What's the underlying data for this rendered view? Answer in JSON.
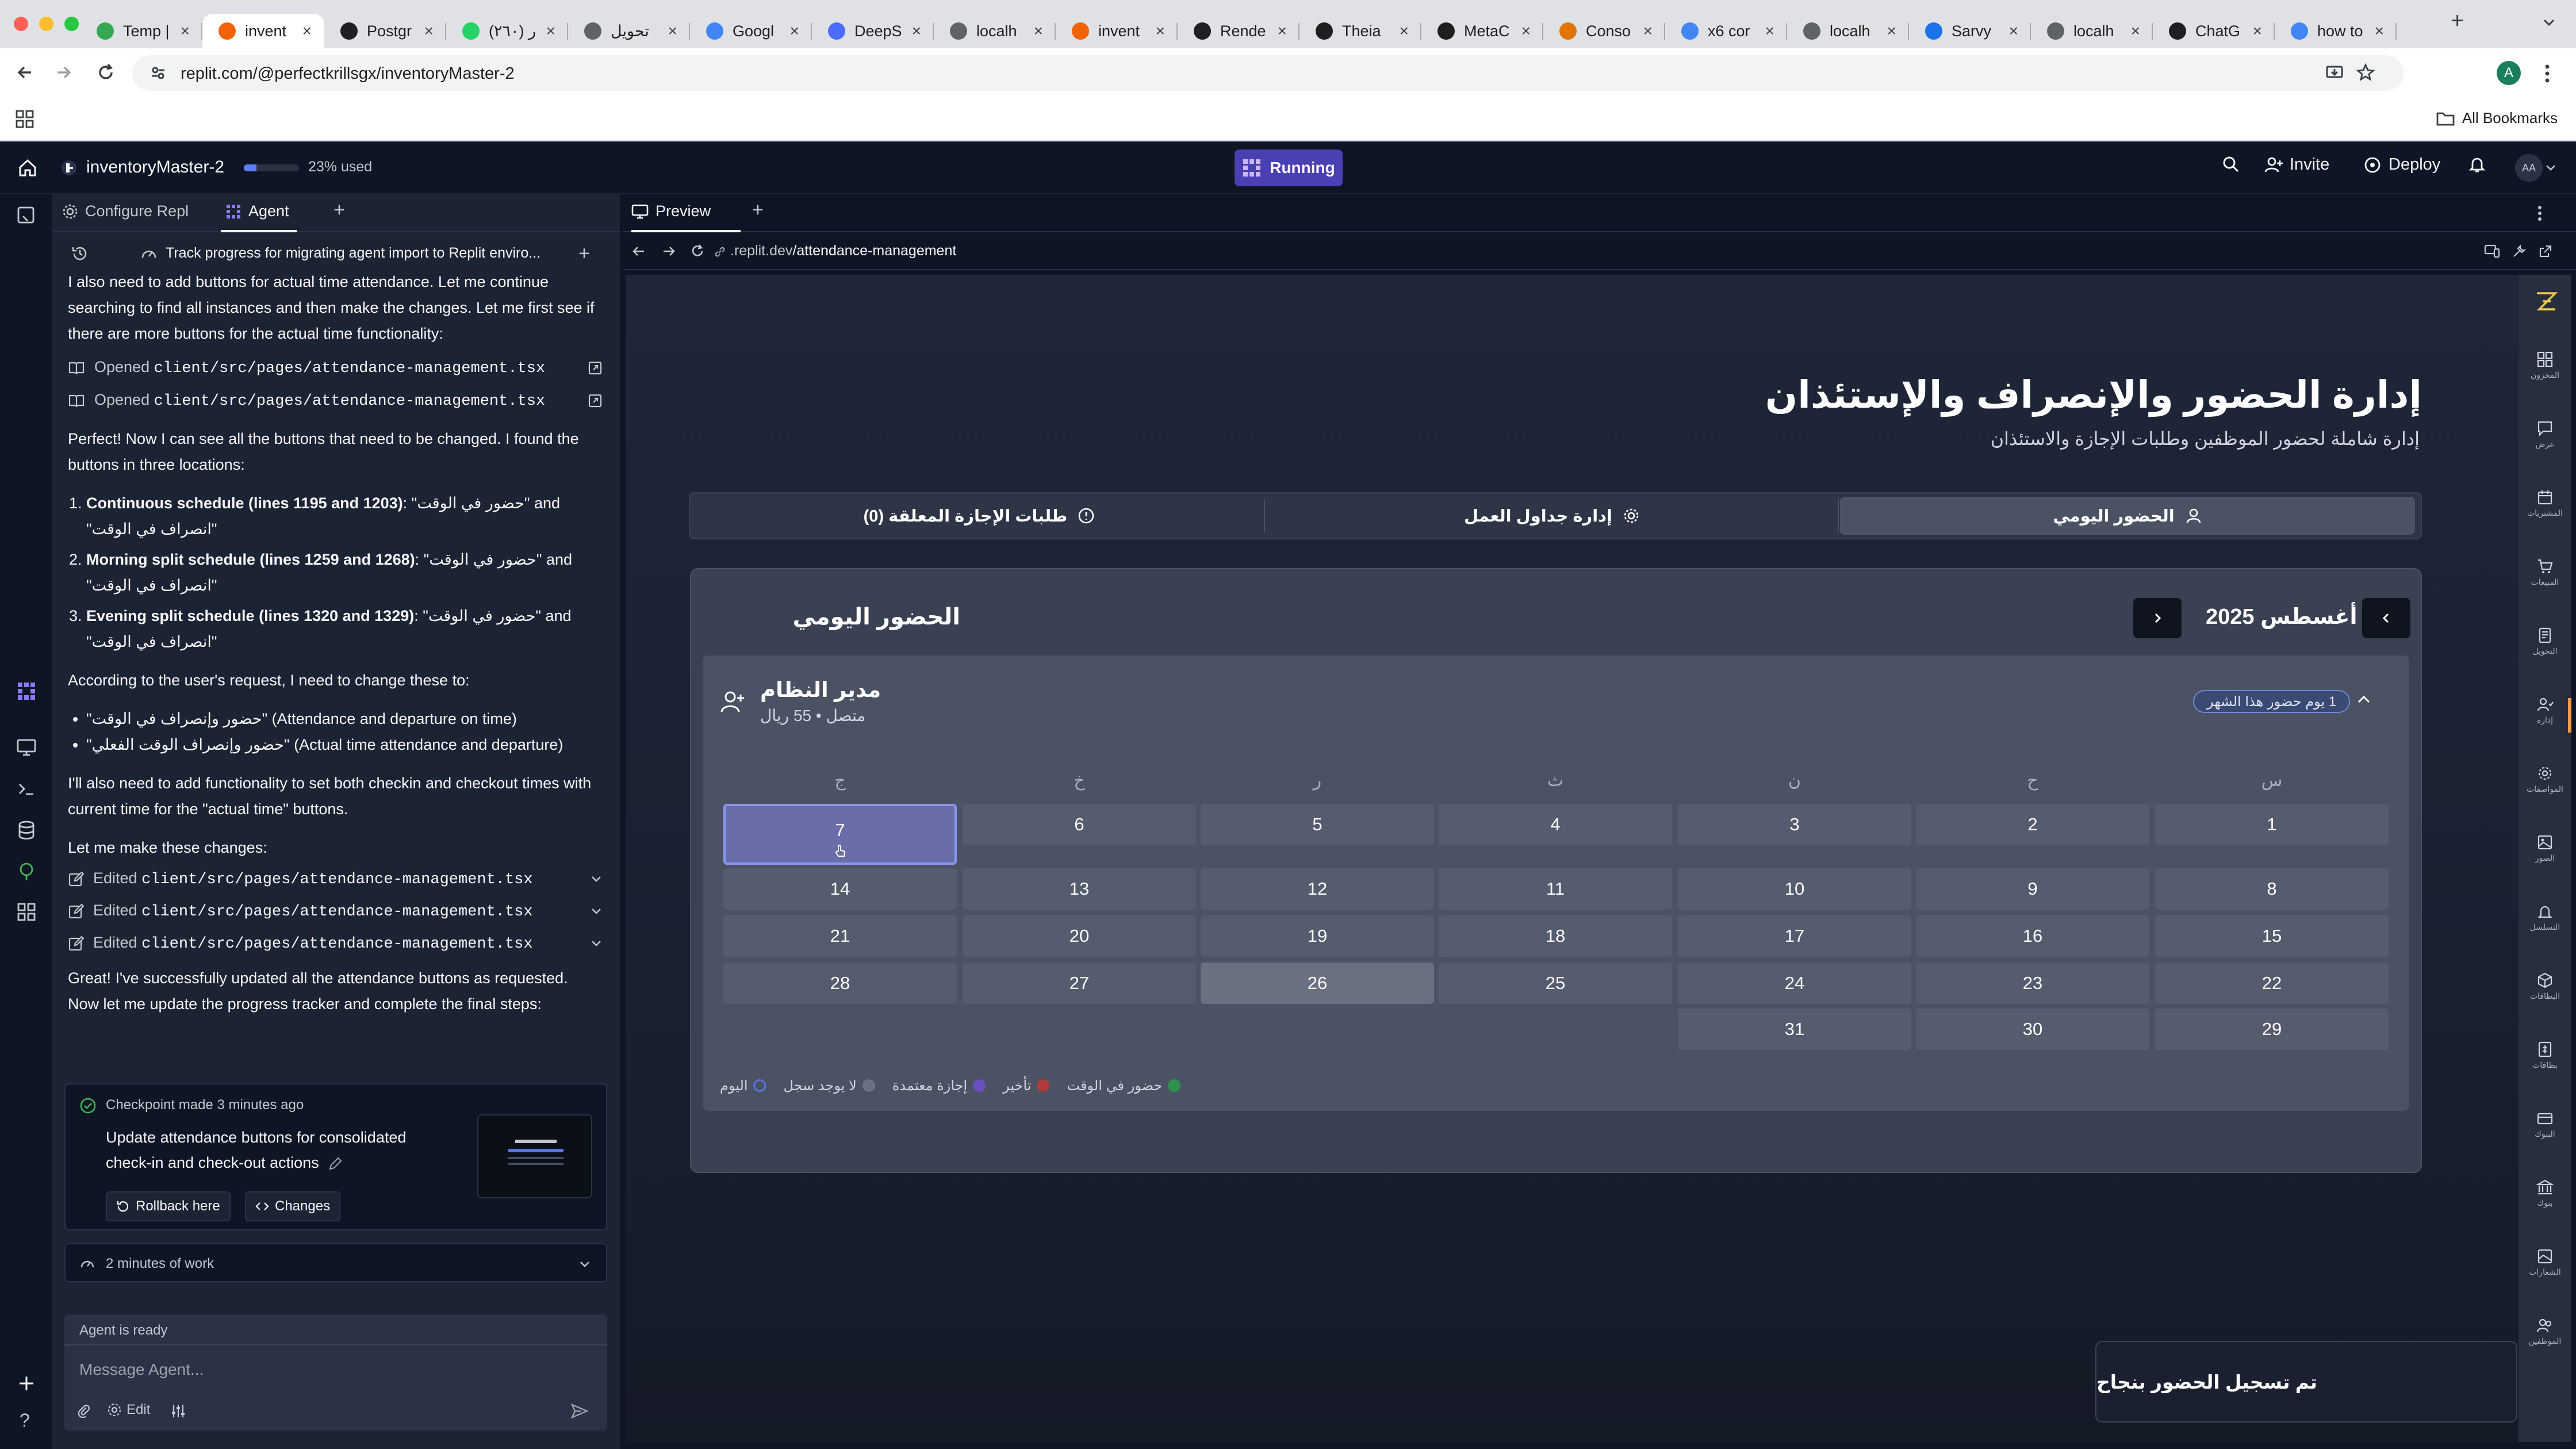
{
  "browser": {
    "tabs": [
      {
        "label": "Temp |",
        "color": "#34a853"
      },
      {
        "label": "invent",
        "color": "#f26207",
        "active": true
      },
      {
        "label": "Postgr",
        "color": "#1f1f1f"
      },
      {
        "label": "(٢٦٠) ر",
        "color": "#25d366"
      },
      {
        "label": "تحويل",
        "color": "#5f6368"
      },
      {
        "label": "Googl",
        "color": "#4285f4"
      },
      {
        "label": "DeepS",
        "color": "#4d6bfe"
      },
      {
        "label": "localh",
        "color": "#5f6368"
      },
      {
        "label": "invent",
        "color": "#f26207"
      },
      {
        "label": "Rende",
        "color": "#1f1f1f"
      },
      {
        "label": "Theia",
        "color": "#1f1f1f"
      },
      {
        "label": "MetaC",
        "color": "#1f1f1f"
      },
      {
        "label": "Conso",
        "color": "#e37400"
      },
      {
        "label": "x6 cor",
        "color": "#4285f4"
      },
      {
        "label": "localh",
        "color": "#5f6368"
      },
      {
        "label": "Sarvy",
        "color": "#1a73e8"
      },
      {
        "label": "localh",
        "color": "#5f6368"
      },
      {
        "label": "ChatG",
        "color": "#1f1f1f"
      },
      {
        "label": "how to",
        "color": "#4285f4"
      }
    ],
    "url": "replit.com/@perfectkrillsgx/inventoryMaster-2",
    "all_bookmarks": "All Bookmarks",
    "profile_initial": "A"
  },
  "replit": {
    "project_name": "inventoryMaster-2",
    "usage_percent": 23,
    "usage_text": "23% used",
    "running": "Running",
    "invite": "Invite",
    "deploy": "Deploy",
    "avatar": "AA"
  },
  "agent_panel": {
    "tabs": {
      "configure": "Configure Repl",
      "agent": "Agent"
    },
    "progress_title": "Track progress for migrating agent import to Replit enviro...",
    "intro": "I also need to add buttons for actual time attendance. Let me continue searching to find all instances and then make the changes. Let me first see if there are more buttons for the actual time functionality:",
    "opened": [
      {
        "prefix": "Opened",
        "file": "client/src/pages/attendance-management.tsx"
      },
      {
        "prefix": "Opened",
        "file": "client/src/pages/attendance-management.tsx"
      }
    ],
    "found_text": "Perfect! Now I can see all the buttons that need to be changed. I found the buttons in three locations:",
    "locations": [
      {
        "bold": "Continuous schedule (lines 1195 and 1203)",
        "rest": ": \"حضور في الوقت\" and \"انصراف في الوقت\""
      },
      {
        "bold": "Morning split schedule (lines 1259 and 1268)",
        "rest": ": \"حضور في الوقت\" and \"انصراف في الوقت\""
      },
      {
        "bold": "Evening split schedule (lines 1320 and 1329)",
        "rest": ": \"حضور في الوقت\" and \"انصراف في الوقت\""
      }
    ],
    "request_text": "According to the user's request, I need to change these to:",
    "changes": [
      "\"حضور وإنصراف في الوقت\" (Attendance and departure on time)",
      "\"حضور وإنصراف الوقت الفعلي\" (Actual time attendance and departure)"
    ],
    "functionality_text": "I'll also need to add functionality to set both checkin and checkout times with current time for the \"actual time\" buttons.",
    "make_changes": "Let me make these changes:",
    "edited": [
      {
        "prefix": "Edited",
        "file": "client/src/pages/attendance-management.tsx"
      },
      {
        "prefix": "Edited",
        "file": "client/src/pages/attendance-management.tsx"
      },
      {
        "prefix": "Edited",
        "file": "client/src/pages/attendance-management.tsx"
      }
    ],
    "done_text": "Great! I've successfully updated all the attendance buttons as requested. Now let me update the progress tracker and complete the final steps:",
    "checkpoint": {
      "header": "Checkpoint made 3 minutes ago",
      "description": "Update attendance buttons for consolidated check-in and check-out actions",
      "rollback": "Rollback here",
      "changes": "Changes"
    },
    "work": "2 minutes of work",
    "status": "Agent is ready",
    "input_placeholder": "Message Agent...",
    "edit_label": "Edit"
  },
  "preview": {
    "tab_label": "Preview",
    "url_domain": ".replit.dev",
    "url_path": "/attendance-management"
  },
  "app": {
    "title": "إدارة الحضور والإنصراف والإستئذان",
    "subtitle": "إدارة شاملة لحضور الموظفين وطلبات الإجازة والاستئذان",
    "tabs": {
      "daily": "الحضور اليومي",
      "schedules": "إدارة جداول العمل",
      "leave": "طلبات الإجازة المعلقة (0)"
    },
    "card_title": "الحضور اليومي",
    "month": "أغسطس 2025",
    "user_name": "مدير النظام",
    "user_sub": "متصل • 55 ريال",
    "month_badge": "1 يوم حضور هذا الشهر",
    "weekdays": [
      "س",
      "ح",
      "ن",
      "ث",
      "ر",
      "خ",
      "ج"
    ],
    "today": 7,
    "selected_day": 26,
    "days": [
      1,
      2,
      3,
      4,
      5,
      6,
      7,
      8,
      9,
      10,
      11,
      12,
      13,
      14,
      15,
      16,
      17,
      18,
      19,
      20,
      21,
      22,
      23,
      24,
      25,
      26,
      27,
      28,
      29,
      30,
      31
    ],
    "legend": [
      {
        "label": "حضور في الوقت",
        "color": "#2f8f4e"
      },
      {
        "label": "تأخير",
        "color": "#b33a3a"
      },
      {
        "label": "إجازة معتمدة",
        "color": "#6a4fc0"
      },
      {
        "label": "لا يوجد سجل",
        "color": "#6b7180"
      },
      {
        "label": "اليوم",
        "color": "#5b74e0"
      }
    ],
    "sidebar": [
      "المخزون",
      "عرض",
      "المشتريات",
      "المبيعات",
      "التحويل",
      "إدارة",
      "المواصفات",
      "الصور",
      "التسلسل",
      "البطاقات",
      "بطاقات",
      "البنوك",
      "بنوك",
      "الشعارات",
      "الموظفين"
    ],
    "toast": "تم تسجيل الحضور بنجاح"
  }
}
